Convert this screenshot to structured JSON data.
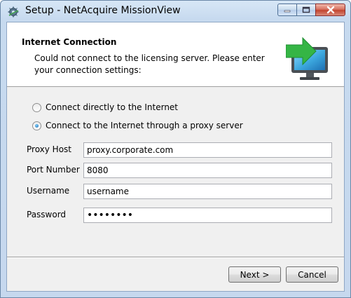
{
  "window": {
    "title": "Setup - NetAcquire MissionView",
    "buttons": [
      "minimize",
      "maximize",
      "close"
    ],
    "icons": {
      "app": "setup-gear-icon",
      "minimize": "minimize-icon",
      "maximize": "maximize-icon",
      "close": "close-icon"
    },
    "colors": {
      "title_bar": "#c9dcf0",
      "close_button": "#c9452f"
    }
  },
  "header": {
    "title": "Internet Connection",
    "description": "Could not connect to the licensing server. Please enter your connection settings:",
    "image": "monitor-arrow-icon",
    "image_colors": {
      "arrow": "#36b847",
      "screen": "#3ba6dd"
    }
  },
  "connection": {
    "options": [
      {
        "label": "Connect directly to the Internet",
        "selected": false
      },
      {
        "label": "Connect to the Internet through a proxy server",
        "selected": true
      }
    ]
  },
  "proxy": {
    "fields": [
      {
        "label": "Proxy Host",
        "value": "proxy.corporate.com"
      },
      {
        "label": "Port Number",
        "value": "8080"
      },
      {
        "label": "Username",
        "value": "username"
      },
      {
        "label": "Password",
        "value": "••••••••"
      }
    ]
  },
  "footer": {
    "next_label": "Next >",
    "cancel_label": "Cancel"
  }
}
